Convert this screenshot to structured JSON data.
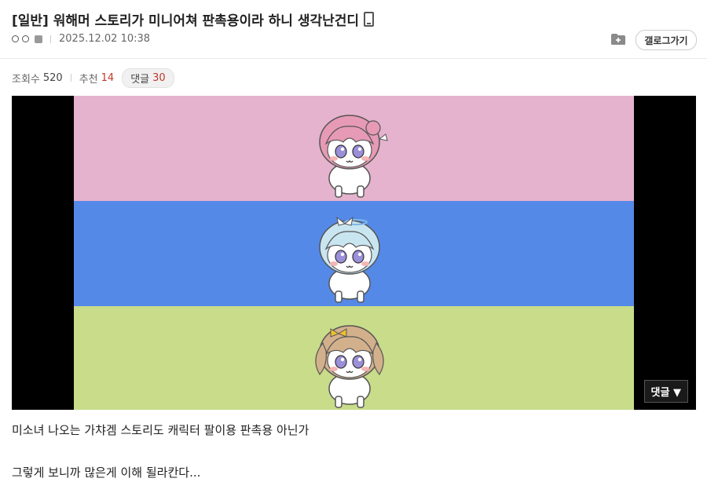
{
  "post": {
    "title": "[일반] 워해머 스토리가 미니어쳐 판촉용이라 하니 생각난건디",
    "title_icon": "mobile-phone-icon",
    "date": "2025.12.02 10:38",
    "gallery_button": "갤로그가기",
    "stats": {
      "views_label": "조회수",
      "views": "520",
      "recommend_label": "추천",
      "recommend": "14",
      "reply_label": "댓글",
      "reply_count": "30"
    },
    "media": {
      "stripe_colors": [
        "#e5b3cd",
        "#5589e8",
        "#c8dc8a"
      ],
      "overlay_label": "댓글 ▼"
    },
    "body_lines": [
      "미소녀 나오는 가챠겜 스토리도 캐릭터 팔이용 판촉용 아닌가",
      "그렇게 보니까 많은게 이해 될라칸다..."
    ]
  }
}
